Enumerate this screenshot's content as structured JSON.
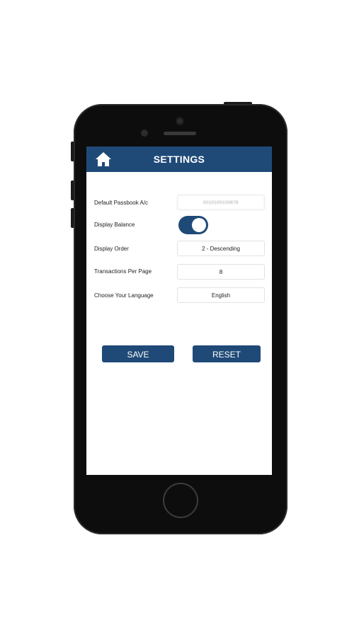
{
  "header": {
    "title": "SETTINGS",
    "home_icon": "home-icon"
  },
  "settings": [
    {
      "label": "Default Passbook A/c",
      "value": "0010100100678",
      "masked": true
    },
    {
      "label": "Display Balance",
      "type": "toggle",
      "value": true
    },
    {
      "label": "Display Order",
      "value": "2 - Descending"
    },
    {
      "label": "Transactions Per Page",
      "value": "8"
    },
    {
      "label": "Choose Your Language",
      "value": "English"
    }
  ],
  "actions": {
    "save_label": "SAVE",
    "reset_label": "RESET"
  },
  "colors": {
    "primary": "#1f4a78",
    "background": "#ffffff",
    "device": "#0d0d0d"
  }
}
